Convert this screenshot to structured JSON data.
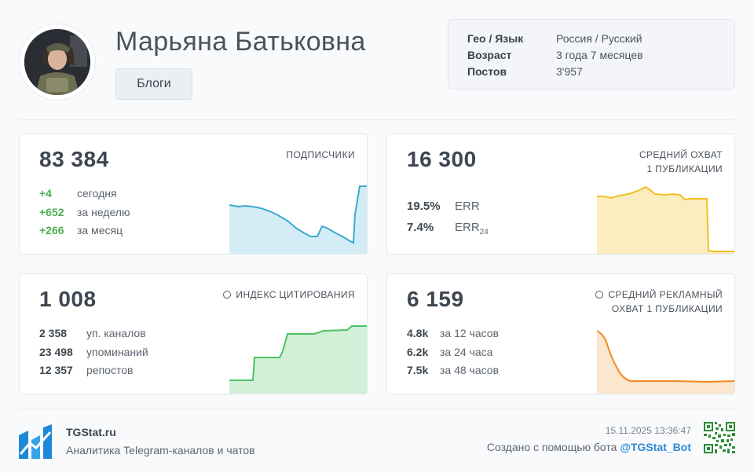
{
  "profile": {
    "name": "Марьяна Батьковна",
    "category": "Блоги",
    "info": [
      {
        "key": "Гео / Язык",
        "value": "Россия / Русский"
      },
      {
        "key": "Возраст",
        "value": "3 года 7 месяцев"
      },
      {
        "key": "Постов",
        "value": "3'957"
      }
    ]
  },
  "cards": {
    "subscribers": {
      "value": "83 384",
      "title": "ПОДПИСЧИКИ",
      "rows": [
        {
          "delta": "+4",
          "label": "сегодня"
        },
        {
          "delta": "+652",
          "label": "за неделю"
        },
        {
          "delta": "+266",
          "label": "за месяц"
        }
      ],
      "color": "#3aaad3"
    },
    "reach": {
      "value": "16 300",
      "title_line1": "СРЕДНИЙ ОХВАТ",
      "title_line2": "1 ПУБЛИКАЦИИ",
      "err_value": "19.5%",
      "err_label": "ERR",
      "err24_value": "7.4%",
      "err24_label": "ERR",
      "err24_sub": "24",
      "color": "#f2c01e"
    },
    "citation": {
      "value": "1 008",
      "title": "ИНДЕКС ЦИТИРОВАНИЯ",
      "icon": "info-icon",
      "rows": [
        {
          "value": "2 358",
          "label": "уп. каналов"
        },
        {
          "value": "23 498",
          "label": "упоминаний"
        },
        {
          "value": "12 357",
          "label": "репостов"
        }
      ],
      "color": "#4cc363"
    },
    "ad_reach": {
      "value": "6 159",
      "title_line1": "СРЕДНИЙ РЕКЛАМНЫЙ",
      "title_line2": "ОХВАТ 1 ПУБЛИКАЦИИ",
      "icon": "info-icon",
      "rows": [
        {
          "value": "4.8k",
          "label": "за 12 часов"
        },
        {
          "value": "6.2k",
          "label": "за 24 часа"
        },
        {
          "value": "7.5k",
          "label": "за 48 часов"
        }
      ],
      "color": "#ef8c1e"
    }
  },
  "footer": {
    "brand": "TGStat.ru",
    "tagline": "Аналитика Telegram-каналов и чатов",
    "timestamp": "15.11.2025 13:36:47",
    "credit_prefix": "Создано с помощью бота",
    "bot": "@TGStat_Bot"
  }
}
